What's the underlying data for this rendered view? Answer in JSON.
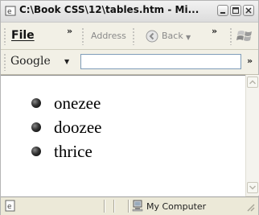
{
  "window": {
    "title": "C:\\Book CSS\\12\\tables.htm - Mi..."
  },
  "menu": {
    "file_label": "File",
    "overflow": "»"
  },
  "toolbar": {
    "address_label": "Address",
    "back_label": "Back",
    "overflow": "»"
  },
  "google": {
    "label": "Google",
    "search_value": "",
    "overflow": "»"
  },
  "content": {
    "items": [
      "onezee",
      "doozee",
      "thrice"
    ]
  },
  "status": {
    "zone_label": "My Computer"
  }
}
